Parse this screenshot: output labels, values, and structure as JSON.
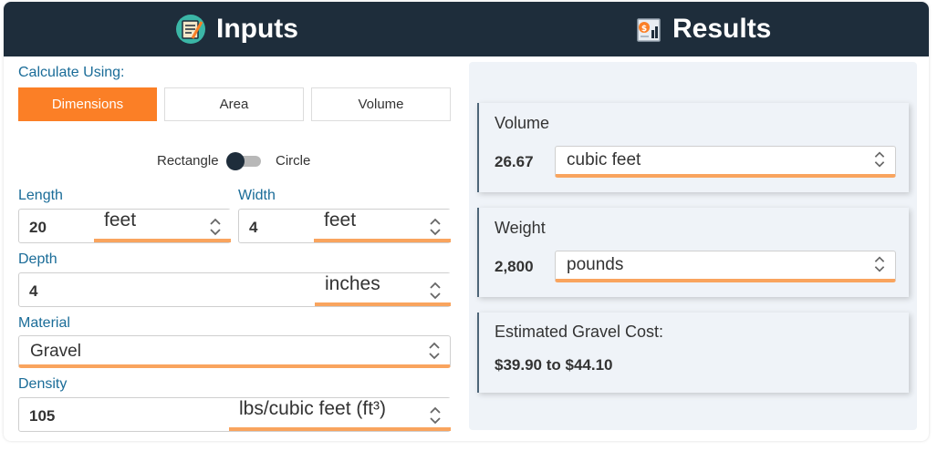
{
  "header": {
    "inputs_title": "Inputs",
    "results_title": "Results"
  },
  "inputs": {
    "calc_using_label": "Calculate Using:",
    "modes": [
      {
        "label": "Dimensions",
        "active": true
      },
      {
        "label": "Area",
        "active": false
      },
      {
        "label": "Volume",
        "active": false
      }
    ],
    "shape_toggle": {
      "left_label": "Rectangle",
      "right_label": "Circle",
      "selected": "Rectangle"
    },
    "length": {
      "label": "Length",
      "value": "20",
      "unit": "feet"
    },
    "width": {
      "label": "Width",
      "value": "4",
      "unit": "feet"
    },
    "depth": {
      "label": "Depth",
      "value": "4",
      "unit": "inches"
    },
    "material": {
      "label": "Material",
      "value": "Gravel"
    },
    "density": {
      "label": "Density",
      "value": "105",
      "unit": "lbs/cubic feet (ft³)"
    }
  },
  "results": {
    "volume": {
      "label": "Volume",
      "value": "26.67",
      "unit": "cubic feet"
    },
    "weight": {
      "label": "Weight",
      "value": "2,800",
      "unit": "pounds"
    },
    "cost": {
      "label": "Estimated Gravel Cost:",
      "value": "$39.90 to $44.10"
    }
  },
  "colors": {
    "header_bg": "#1e2d3b",
    "accent": "#fb7f26",
    "underline": "#f9a45e",
    "label_blue": "#1a6c98",
    "results_bg": "#eff3f8"
  }
}
